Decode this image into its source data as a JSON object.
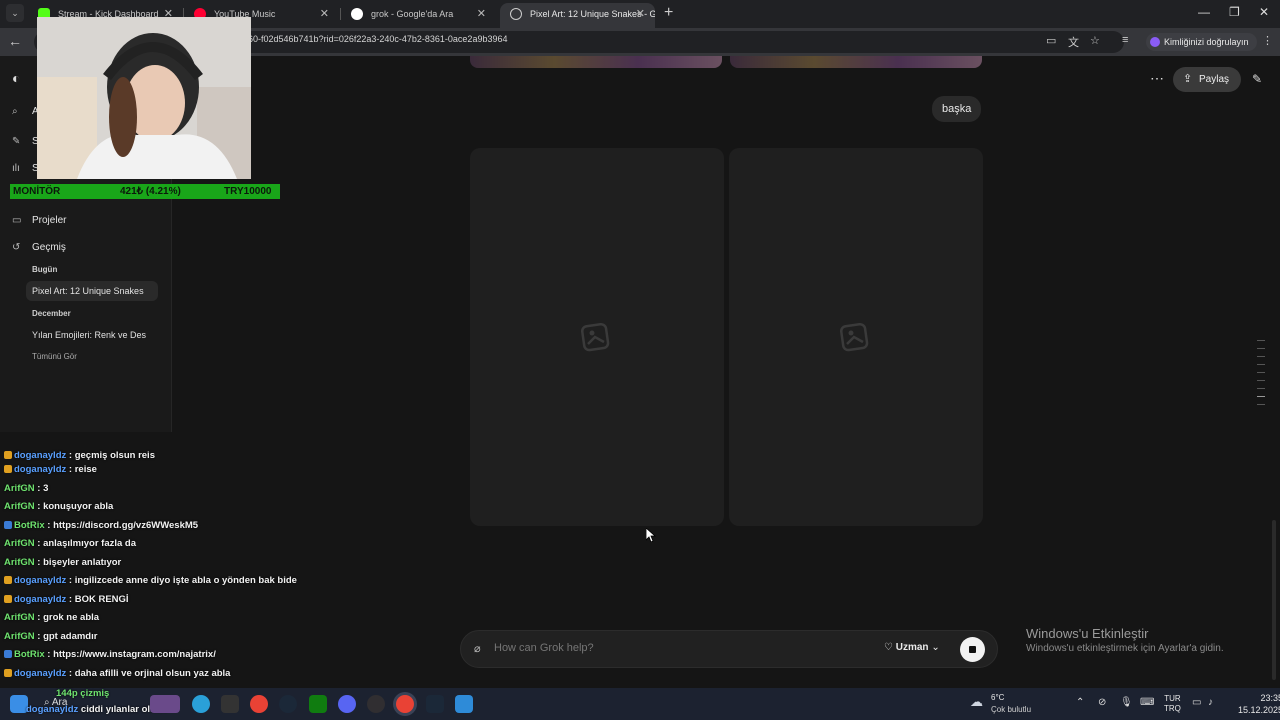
{
  "browser": {
    "tabs": [
      {
        "title": "Stream - Kick Dashboard",
        "favicon_color": "#53fc18",
        "active": false
      },
      {
        "title": "YouTube Music",
        "favicon_color": "#ff0033",
        "active": false
      },
      {
        "title": "grok - Google'da Ara",
        "favicon_color": "#4285f4",
        "active": false
      },
      {
        "title": "Pixel Art: 12 Unique Snakes - G",
        "favicon_color": "#cccccc",
        "active": true
      }
    ],
    "url": "60-f02d546b741b?rid=026f22a3-240c-47b2-8361-0ace2a9b3964",
    "profile_label": "Kimliğinizi doğrulayın"
  },
  "sidebar": {
    "item_search_initial": "A",
    "item_2_initial": "S",
    "item_3_initial": "S",
    "projects": "Projeler",
    "history": "Geçmiş",
    "today": "Bugün",
    "chat_today": "Pixel Art: 12 Unique Snakes",
    "december": "December",
    "chat_december": "Yılan Emojileri: Renk ve Des",
    "see_all": "Tümünü Gör"
  },
  "chat": {
    "user_message": "başka",
    "share_label": "Paylaş",
    "composer_placeholder": "How can Grok help?",
    "mode_label": "Uzman",
    "image_count": 2
  },
  "windows_activation": {
    "title": "Windows'u Etkinleştir",
    "subtitle": "Windows'u etkinleştirmek için Ayarlar'a gidin."
  },
  "stream_overlay": {
    "monitor_label": "MONİTÖR",
    "monitor_value": "421₺ (4.21%)",
    "monitor_goal": "TRY10000",
    "chat_messages": [
      {
        "user": "doganayldz",
        "text": "geçmiş olsun reis",
        "color": "#5aa0ff"
      },
      {
        "user": "doganayldz",
        "text": "reise",
        "color": "#5aa0ff"
      },
      {
        "user": "ArifGN",
        "text": "3",
        "color": "#6fe36f"
      },
      {
        "user": "ArifGN",
        "text": "konuşuyor abla",
        "color": "#6fe36f"
      },
      {
        "user": "BotRix",
        "text": "https://discord.gg/vz6WWeskM5",
        "color": "#6fe36f"
      },
      {
        "user": "ArifGN",
        "text": "anlaşılmıyor fazla da",
        "color": "#6fe36f"
      },
      {
        "user": "ArifGN",
        "text": "bişeyler anlatıyor",
        "color": "#6fe36f"
      },
      {
        "user": "doganayldz",
        "text": "ingilizcede anne diyo işte abla o yönden bak bide",
        "color": "#5aa0ff"
      },
      {
        "user": "doganayldz",
        "text": "BOK RENGİ",
        "color": "#5aa0ff"
      },
      {
        "user": "ArifGN",
        "text": "grok ne abla",
        "color": "#6fe36f"
      },
      {
        "user": "ArifGN",
        "text": "gpt adamdır",
        "color": "#6fe36f"
      },
      {
        "user": "BotRix",
        "text": "https://www.instagram.com/najatrix/",
        "color": "#6fe36f"
      },
      {
        "user": "doganayldz",
        "text": "daha afilli ve orjinal olsun yaz abla",
        "color": "#5aa0ff"
      },
      {
        "user": "",
        "text": "144p çizmiş",
        "color": "#6fe36f"
      },
      {
        "user": "doganayldz",
        "text": "ciddi yılanlar olsun",
        "color": "#5aa0ff"
      }
    ]
  },
  "taskbar": {
    "search_label": "Ara",
    "weather_temp": "6°C",
    "weather_desc": "Çok bulutlu",
    "lang_1": "TUR",
    "lang_2": "TRQ",
    "time": "23:35",
    "date": "15.12.2025"
  }
}
